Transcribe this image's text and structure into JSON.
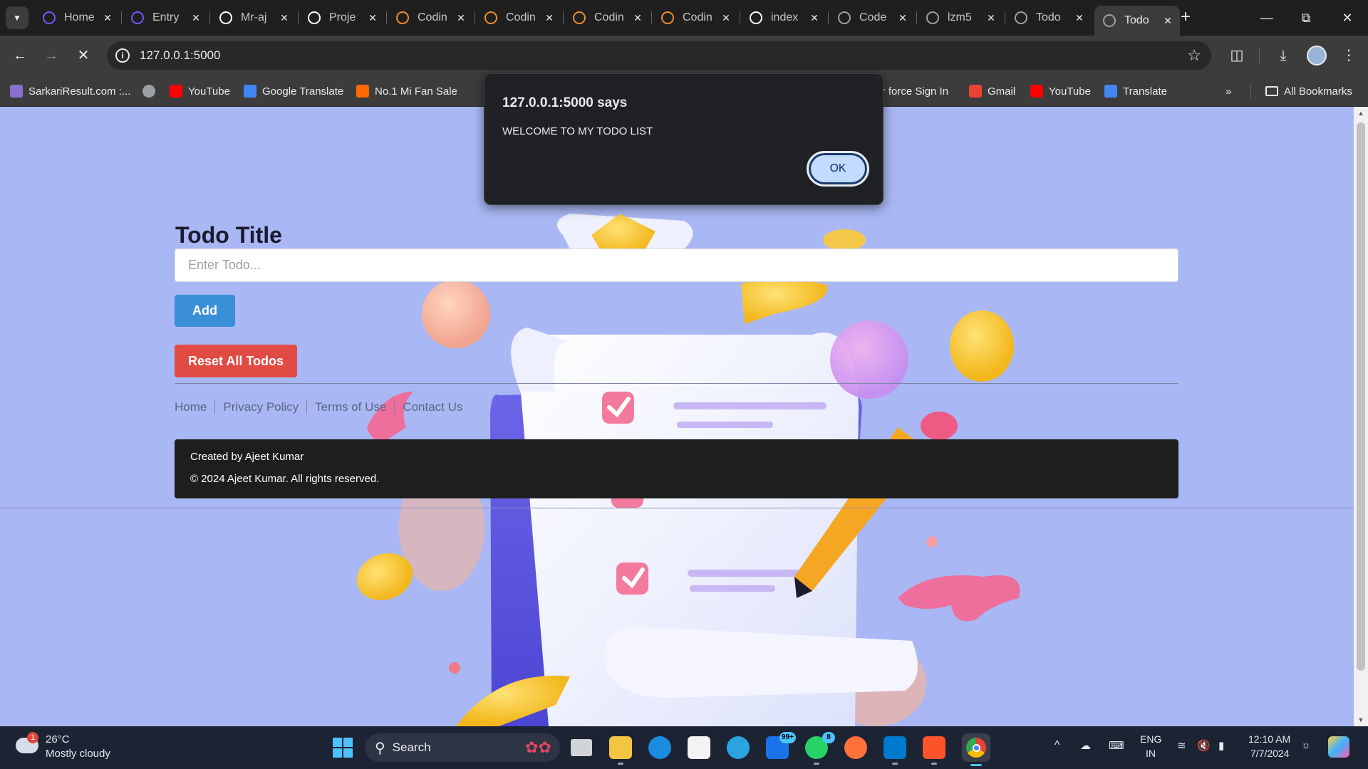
{
  "browser": {
    "tabs": [
      {
        "label": "Home",
        "favicon": "c-logo-icon",
        "color": "#6b5cff"
      },
      {
        "label": "Entry",
        "favicon": "c-logo-icon",
        "color": "#6b5cff"
      },
      {
        "label": "Mr-aj",
        "favicon": "github-icon",
        "color": "#ffffff"
      },
      {
        "label": "Proje",
        "favicon": "openai-icon",
        "color": "#ffffff"
      },
      {
        "label": "Codin",
        "favicon": "codewithharry-icon",
        "color": "#f28b2c"
      },
      {
        "label": "Codin",
        "favicon": "codewithharry-icon",
        "color": "#f28b2c"
      },
      {
        "label": "Codin",
        "favicon": "codewithharry-icon",
        "color": "#f28b2c"
      },
      {
        "label": "Codin",
        "favicon": "codewithharry-icon",
        "color": "#f28b2c"
      },
      {
        "label": "index",
        "favicon": "file-icon",
        "color": "#ffffff"
      },
      {
        "label": "Code",
        "favicon": "globe-icon",
        "color": "#9aa0a6"
      },
      {
        "label": "lzm5",
        "favicon": "globe-icon",
        "color": "#9aa0a6"
      },
      {
        "label": "Todo",
        "favicon": "globe-icon",
        "color": "#9aa0a6"
      },
      {
        "label": "Todo",
        "favicon": "loading-icon",
        "color": "#9aa0a6",
        "active": true
      }
    ],
    "url": "127.0.0.1:5000",
    "bookmarks": [
      {
        "label": "SarkariResult.com :...",
        "icon": "sarkari-icon",
        "color": "#8a6fd1"
      },
      {
        "label": "",
        "icon": "globe-icon",
        "color": "#9aa0a6"
      },
      {
        "label": "YouTube",
        "icon": "youtube-icon",
        "color": "#ff0000"
      },
      {
        "label": "Google Translate",
        "icon": "translate-icon",
        "color": "#4285f4"
      },
      {
        "label": "No.1 Mi Fan Sale",
        "icon": "mi-icon",
        "color": "#ff6900"
      },
      {
        "label": "air force Sign In",
        "icon": "",
        "color": ""
      },
      {
        "label": "Gmail",
        "icon": "gmail-icon",
        "color": "#ea4335"
      },
      {
        "label": "YouTube",
        "icon": "youtube-icon",
        "color": "#ff0000"
      },
      {
        "label": "Translate",
        "icon": "translate-icon",
        "color": "#4285f4"
      }
    ],
    "all_bookmarks": "All Bookmarks"
  },
  "page": {
    "title": "Todo Title",
    "input_placeholder": "Enter Todo...",
    "add_label": "Add",
    "reset_label": "Reset All Todos",
    "footer_links": [
      "Home",
      "Privacy Policy",
      "Terms of Use",
      "Contact Us"
    ],
    "footer_created": "Created by Ajeet Kumar",
    "footer_copyright": "© 2024 Ajeet Kumar. All rights reserved.",
    "colors": {
      "add": "#3a8fd9",
      "reset": "#e24b43",
      "background": "#a9b8f4"
    }
  },
  "alert": {
    "title": "127.0.0.1:5000 says",
    "message": "WELCOME TO MY TODO LIST",
    "ok_label": "OK"
  },
  "taskbar": {
    "weather_temp": "26°C",
    "weather_desc": "Mostly cloudy",
    "weather_badge": "1",
    "search_label": "Search",
    "badge_mail": "99+",
    "badge_whatsapp": "8",
    "lang": "ENG",
    "region": "IN",
    "time": "12:10 AM",
    "date": "7/7/2024"
  }
}
